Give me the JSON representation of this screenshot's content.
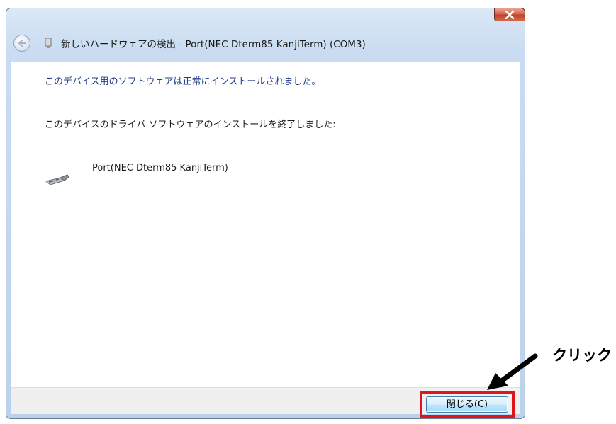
{
  "window": {
    "title": "新しいハードウェアの検出 - Port(NEC Dterm85 KanjiTerm) (COM3)",
    "close_icon": "close-icon",
    "back_icon": "back-arrow-icon"
  },
  "content": {
    "heading": "このデバイス用のソフトウェアは正常にインストールされました。",
    "paragraph": "このデバイスのドライバ ソフトウェアのインストールを終了しました:",
    "device": {
      "name": "Port(NEC Dterm85 KanjiTerm)",
      "icon": "serial-port-icon"
    }
  },
  "footer": {
    "close_button_label": "閉じる(C)"
  },
  "annotation": {
    "label": "クリック",
    "highlight_color": "#e0141b"
  }
}
